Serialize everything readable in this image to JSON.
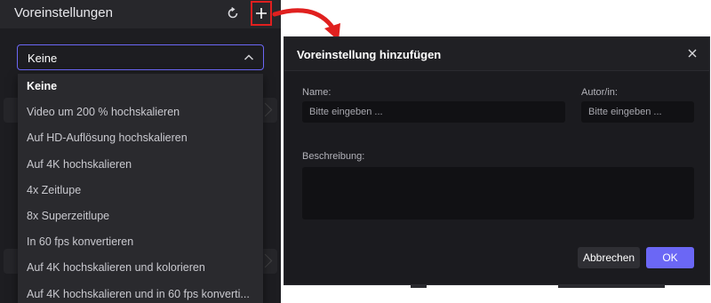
{
  "left_panel": {
    "title": "Voreinstellungen",
    "select": {
      "value": "Keine"
    },
    "dropdown": [
      {
        "label": "Keine",
        "selected": true
      },
      {
        "label": "Video um 200 % hochskalieren"
      },
      {
        "label": "Auf HD-Auflösung hochskalieren"
      },
      {
        "label": "Auf 4K hochskalieren"
      },
      {
        "label": "4x Zeitlupe"
      },
      {
        "label": "8x Superzeitlupe"
      },
      {
        "label": "In 60 fps konvertieren"
      },
      {
        "label": "Auf 4K hochskalieren und kolorieren"
      },
      {
        "label": "Auf 4K hochskalieren und in 60 fps konverti..."
      }
    ],
    "icons": {
      "reset": "refresh-icon",
      "add": "plus-icon",
      "chevron": "chevron-up-icon"
    }
  },
  "dialog": {
    "title": "Voreinstellung hinzufügen",
    "name_label": "Name:",
    "name_placeholder": "Bitte eingeben ...",
    "author_label": "Autor/in:",
    "author_placeholder": "Bitte eingeben ...",
    "description_label": "Beschreibung:",
    "cancel_label": "Abbrechen",
    "ok_label": "OK"
  },
  "colors": {
    "accent": "#6b67f5",
    "highlight_border": "#e01f1f",
    "arrow": "#e0201f",
    "panel_bg": "#1d1d21"
  }
}
